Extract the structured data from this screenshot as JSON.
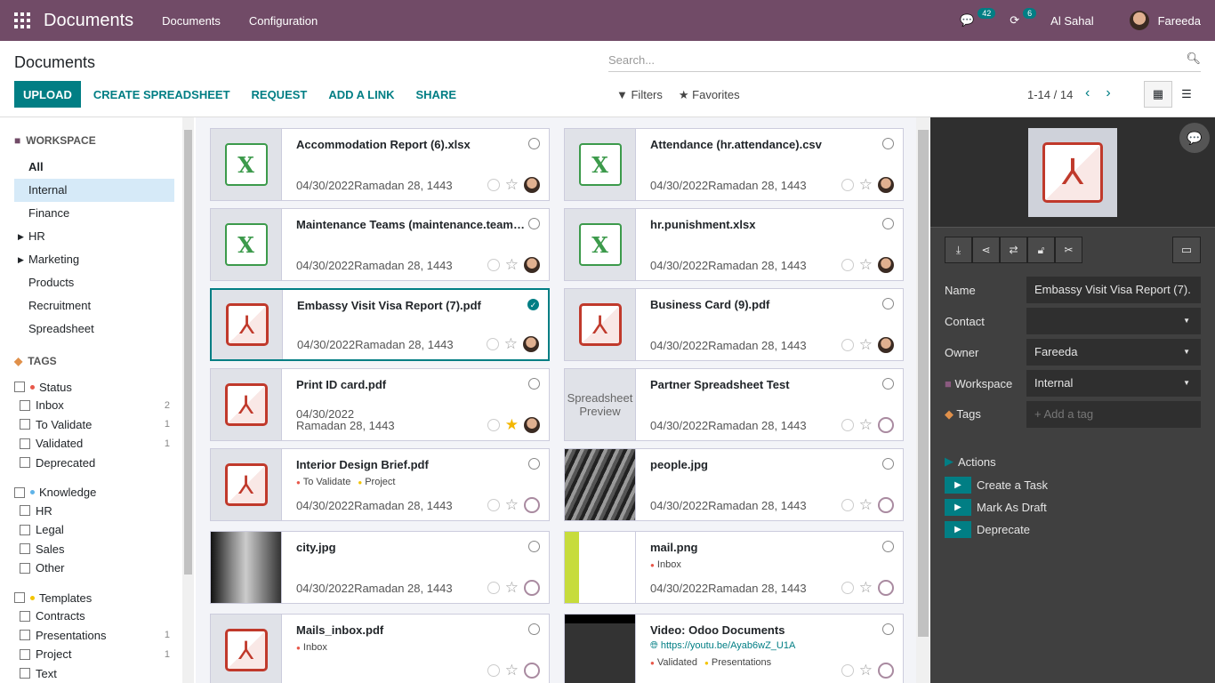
{
  "nav": {
    "app": "Documents",
    "menus": [
      "Documents",
      "Configuration"
    ],
    "messages_count": "42",
    "activities_count": "6",
    "company": "Al Sahal",
    "user": "Fareeda",
    "color": "#714b67"
  },
  "control": {
    "title": "Documents",
    "search_placeholder": "Search...",
    "buttons": [
      "Upload",
      "Create Spreadsheet",
      "Request",
      "Add a link",
      "Share"
    ],
    "filters": "Filters",
    "favorites": "Favorites",
    "pager": "1-14 / 14",
    "view": "kanban"
  },
  "sidebar": {
    "workspace_title": "WORKSPACE",
    "workspaces": [
      {
        "label": "All",
        "bold": true
      },
      {
        "label": "Internal",
        "selected": true
      },
      {
        "label": "Finance"
      },
      {
        "label": "HR",
        "caret": true
      },
      {
        "label": "Marketing",
        "caret": true
      },
      {
        "label": "Products"
      },
      {
        "label": "Recruitment"
      },
      {
        "label": "Spreadsheet"
      }
    ],
    "tags_title": "TAGS",
    "tag_groups": [
      {
        "label": "Status",
        "color": "#e8584a",
        "items": [
          {
            "label": "Inbox",
            "count": "2"
          },
          {
            "label": "To Validate",
            "count": "1"
          },
          {
            "label": "Validated",
            "count": "1"
          },
          {
            "label": "Deprecated",
            "count": ""
          }
        ]
      },
      {
        "label": "Knowledge",
        "color": "#5fb3e8",
        "items": [
          {
            "label": "HR",
            "count": ""
          },
          {
            "label": "Legal",
            "count": ""
          },
          {
            "label": "Sales",
            "count": ""
          },
          {
            "label": "Other",
            "count": ""
          }
        ]
      },
      {
        "label": "Templates",
        "color": "#f3c400",
        "items": [
          {
            "label": "Contracts",
            "count": ""
          },
          {
            "label": "Presentations",
            "count": "1"
          },
          {
            "label": "Project",
            "count": "1"
          },
          {
            "label": "Text",
            "count": ""
          }
        ]
      }
    ]
  },
  "documents": [
    {
      "name": "Accommodation Report (6).xlsx",
      "thumb": "xlsx",
      "date": "04/30/2022Ramadan 28, 1443",
      "owner": "photo"
    },
    {
      "name": "Attendance (hr.attendance).csv",
      "thumb": "xlsx",
      "date": "04/30/2022Ramadan 28, 1443",
      "owner": "photo"
    },
    {
      "name": "Maintenance Teams (maintenance.team).xlsx",
      "thumb": "xlsx",
      "date": "04/30/2022Ramadan 28, 1443",
      "owner": "photo"
    },
    {
      "name": "hr.punishment.xlsx",
      "thumb": "xlsx",
      "date": "04/30/2022Ramadan 28, 1443",
      "owner": "photo"
    },
    {
      "name": "Embassy Visit Visa Report (7).pdf",
      "thumb": "pdf",
      "date": "04/30/2022Ramadan 28, 1443",
      "owner": "photo",
      "selected": true
    },
    {
      "name": "Business Card (9).pdf",
      "thumb": "pdf",
      "date": "04/30/2022Ramadan 28, 1443",
      "owner": "photo"
    },
    {
      "name": "Print ID card.pdf",
      "thumb": "pdf",
      "date": "04/30/2022",
      "date2": "Ramadan 28, 1443",
      "owner": "photo",
      "starred": true
    },
    {
      "name": "Partner Spreadsheet Test",
      "thumb": "text",
      "thumb_text": "Spreadsheet Preview",
      "date": "04/30/2022Ramadan 28, 1443",
      "owner": "placeholder"
    },
    {
      "name": "Interior Design Brief.pdf",
      "thumb": "pdf",
      "tags": [
        {
          "label": "To Validate",
          "color": "#e8584a"
        },
        {
          "label": "Project",
          "color": "#f3c400"
        }
      ],
      "date": "04/30/2022Ramadan 28, 1443",
      "owner": "placeholder"
    },
    {
      "name": "people.jpg",
      "thumb": "photo1",
      "date": "04/30/2022Ramadan 28, 1443",
      "owner": "placeholder"
    },
    {
      "name": "city.jpg",
      "thumb": "photo2",
      "date": "04/30/2022Ramadan 28, 1443",
      "owner": "placeholder"
    },
    {
      "name": "mail.png",
      "thumb": "photo3",
      "tags": [
        {
          "label": "Inbox",
          "color": "#e8584a"
        }
      ],
      "date": "04/30/2022Ramadan 28, 1443",
      "owner": "placeholder"
    },
    {
      "name": "Mails_inbox.pdf",
      "thumb": "pdf",
      "tags": [
        {
          "label": "Inbox",
          "color": "#e8584a"
        }
      ],
      "date": "",
      "owner": "placeholder"
    },
    {
      "name": "Video: Odoo Documents",
      "thumb": "photo4",
      "url": "https://youtu.be/Ayab6wZ_U1A",
      "tags": [
        {
          "label": "Validated",
          "color": "#e8584a"
        },
        {
          "label": "Presentations",
          "color": "#f3c400"
        }
      ],
      "date": "",
      "owner": "placeholder"
    }
  ],
  "panel": {
    "fields": [
      {
        "label": "Name",
        "value": "Embassy Visit Visa Report (7)."
      },
      {
        "label": "Contact",
        "value": "",
        "dropdown": true
      },
      {
        "label": "Owner",
        "value": "Fareeda",
        "dropdown": true
      },
      {
        "label": "Workspace",
        "value": "Internal",
        "dropdown": true,
        "icon": "folder-icon"
      },
      {
        "label": "Tags",
        "value": "+ Add a tag",
        "placeholder": true,
        "icon": "tag-icon"
      }
    ],
    "actions_title": "Actions",
    "actions": [
      "Create a Task",
      "Mark As Draft",
      "Deprecate"
    ],
    "tools": [
      "download-icon",
      "share-icon",
      "replace-icon",
      "lock-icon",
      "split-icon"
    ]
  }
}
